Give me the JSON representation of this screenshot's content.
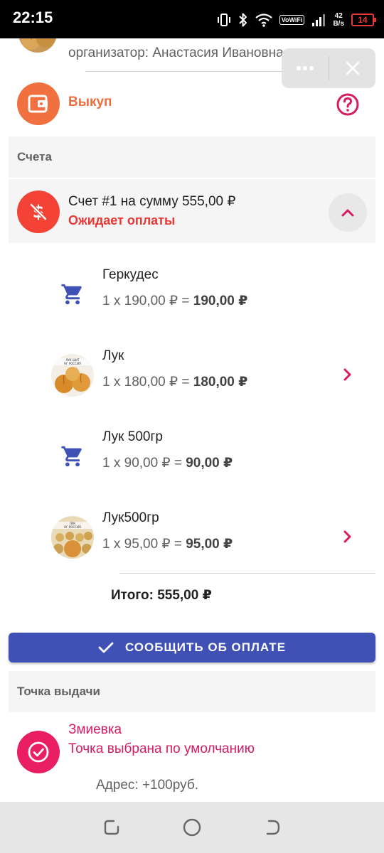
{
  "status_bar": {
    "time": "22:15",
    "net_speed_value": "42",
    "net_speed_unit": "B/s",
    "volte_label": "VoWiFi",
    "battery": "14"
  },
  "organizer": {
    "text": "организатор: Анастасия Ивановна"
  },
  "capsule": {
    "more_icon": "more-dots-icon",
    "close_icon": "close-icon"
  },
  "vykup": {
    "label": "Выкуп",
    "icon": "wallet-icon",
    "help_icon": "help-circle-icon"
  },
  "accounts_section": {
    "title": "Счета"
  },
  "invoice": {
    "title": "Счет #1 на сумму 555,00 ₽",
    "status": "Ожидает оплаты",
    "icon": "money-off-icon",
    "toggle_icon": "chevron-up-icon"
  },
  "items": [
    {
      "name": "Геркудес",
      "qty_price": "1 x 190,00 ₽ = ",
      "total": "190,00 ₽",
      "icon": "cart-icon",
      "has_chevron": false
    },
    {
      "name": "Лук",
      "qty_price": "1 x 180,00 ₽ = ",
      "total": "180,00 ₽",
      "icon": "onion-photo",
      "has_chevron": true
    },
    {
      "name": "Лук 500гр",
      "qty_price": "1 x 90,00 ₽ = ",
      "total": "90,00 ₽",
      "icon": "cart-icon",
      "has_chevron": false
    },
    {
      "name": "Лук500гр",
      "qty_price": "1 x 95,00 ₽ = ",
      "total": "95,00 ₽",
      "icon": "onion-photo",
      "has_chevron": true
    }
  ],
  "total": {
    "text": "Итого: 555,00 ₽"
  },
  "confirm_button": {
    "label": "СООБЩИТЬ ОБ ОПЛАТЕ",
    "icon": "check-icon"
  },
  "pickup_section": {
    "title": "Точка выдачи"
  },
  "pickup": {
    "name": "Змиевка",
    "default_text": "Точка выбрана по умолчанию",
    "address": "Адрес: +100руб.",
    "icon": "check-circle-icon"
  },
  "nav_bar": {
    "recents_icon": "recents-icon",
    "home_icon": "home-circle-icon",
    "back_icon": "back-icon"
  },
  "colors": {
    "accent_blue": "#3f51b5",
    "vykup_orange": "#f07040",
    "status_red": "#e53935",
    "pickup_pink": "#e91e63"
  }
}
